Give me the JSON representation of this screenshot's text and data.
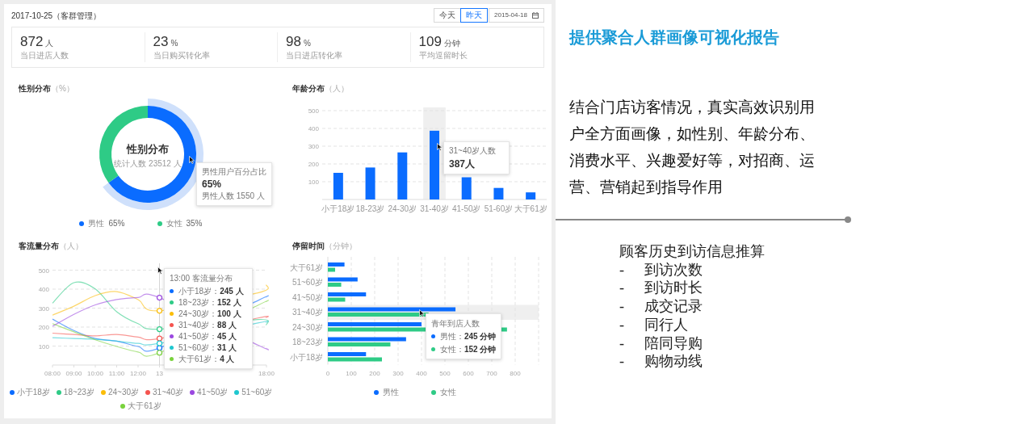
{
  "dashboard": {
    "header": {
      "title": "2017-10-25（客群管理）",
      "buttons": [
        {
          "label": "今天",
          "selected": false
        },
        {
          "label": "昨天",
          "selected": true
        }
      ],
      "date": "2015-04-18"
    },
    "stats": [
      {
        "value": "872",
        "unit": "人",
        "label": "当日进店人数"
      },
      {
        "value": "23",
        "unit": "%",
        "label": "当日购买转化率"
      },
      {
        "value": "98",
        "unit": "%",
        "label": "当日进店转化率"
      },
      {
        "value": "109",
        "unit": "分钟",
        "label": "平均逗留时长"
      }
    ],
    "gender": {
      "title": "性别分布",
      "unit": "（%）",
      "center_title": "性别分布",
      "center_subtitle": "统计人数 23512 人",
      "chart_data": {
        "type": "donut",
        "categories": [
          "男性",
          "女性"
        ],
        "values": [
          65,
          35
        ]
      },
      "legend": [
        {
          "value": "65%",
          "color": "#0a6cff",
          "highlighted": true
        },
        {
          "value": "35%",
          "color": "#2ecb86",
          "highlighted": false
        }
      ],
      "tooltip": {
        "title": "男性用户百分占比",
        "value": "65%",
        "detail": "男性人数 1550 人"
      }
    },
    "age": {
      "title": "年龄分布",
      "unit": "（人）",
      "chart_data": {
        "type": "bar",
        "categories": [
          "小于18岁",
          "18-23岁",
          "24-30岁",
          "31-40岁",
          "41-50岁",
          "51-60岁",
          "大于61岁"
        ],
        "values": [
          150,
          180,
          265,
          387,
          125,
          65,
          40
        ],
        "ylim": [
          0,
          500
        ],
        "yticks": [
          100,
          200,
          300,
          400,
          500
        ],
        "grid": true,
        "bands": [
          {
            "axis": "x",
            "from": "31-40岁",
            "to": "31-40岁"
          }
        ]
      },
      "tooltip": {
        "title": "31~40岁人数",
        "value": "387人"
      }
    },
    "traffic": {
      "title": "客流量分布",
      "unit": "（人）",
      "chart_data": {
        "type": "line",
        "x": [
          8,
          9,
          10,
          11,
          12,
          13,
          17.6,
          18
        ],
        "xlim": [
          8,
          18
        ],
        "xticks": [
          {
            "value": 8,
            "label": "08:00"
          },
          {
            "value": 9,
            "label": "09:00"
          },
          {
            "value": 10,
            "label": "10:00"
          },
          {
            "value": 11,
            "label": "11:00"
          },
          {
            "value": 12,
            "label": "12:00"
          },
          {
            "value": 13,
            "label": "13"
          },
          {
            "value": 18,
            "label": "18:00"
          }
        ],
        "ylim": [
          0,
          500
        ],
        "yticks": [
          100,
          200,
          300,
          400,
          500
        ],
        "grid": true,
        "ref_lines": [
          {
            "axis": "x",
            "value": 13
          }
        ],
        "series": [
          {
            "name": "小于18岁",
            "color": "#0a6cff",
            "values": [
              242,
              182,
              140,
              126,
              98,
              90,
              340,
              359
            ]
          },
          {
            "name": "18~23岁",
            "color": "#2ecb86",
            "values": [
              326,
              434,
              401,
              281,
              218,
              189,
              240,
              211
            ]
          },
          {
            "name": "24~30岁",
            "color": "#fbbd08",
            "values": [
              263,
              310,
              366,
              387,
              345,
              286,
              380,
              423
            ]
          },
          {
            "name": "31~40岁",
            "color": "#f5544f",
            "values": [
              168,
              161,
              154,
              161,
              147,
              140,
              248,
              250
            ]
          },
          {
            "name": "41~50岁",
            "color": "#9b48e0",
            "values": [
              204,
              267,
              317,
              345,
              356,
              355,
              105,
              88
            ]
          },
          {
            "name": "51~60岁",
            "color": "#1fc7cf",
            "values": [
              144,
              140,
              136,
              126,
              114,
              114,
              222,
              225
            ]
          },
          {
            "name": "大于61岁",
            "color": "#79d23c",
            "values": [
              218,
              175,
              133,
              98,
              69,
              65,
              315,
              335
            ]
          }
        ]
      },
      "tooltip": {
        "title": "13:00 客流量分布",
        "rows": [
          {
            "label": "小于18岁：",
            "value": "245 人"
          },
          {
            "label": "18~23岁：",
            "value": "152 人"
          },
          {
            "label": "24~30岁：",
            "value": "100 人"
          },
          {
            "label": "31~40岁：",
            "value": "88 人"
          },
          {
            "label": "41~50岁：",
            "value": "45 人"
          },
          {
            "label": "51~60岁：",
            "value": "31 人"
          },
          {
            "label": "大于61岁：",
            "value": "4 人"
          }
        ]
      }
    },
    "dwell": {
      "title": "停留时间",
      "unit": "（分钟）",
      "chart_data": {
        "type": "bar",
        "orientation": "horizontal",
        "categories": [
          "大于61岁",
          "51~60岁",
          "41~50岁",
          "31~40岁",
          "24~30岁",
          "18~23岁",
          "小于18岁"
        ],
        "xlim": [
          0,
          900
        ],
        "xticks": [
          0,
          100,
          200,
          300,
          400,
          500,
          600,
          700,
          800
        ],
        "grid": true,
        "bands": [
          {
            "axis": "y",
            "from": "31~40岁",
            "to": "31~40岁"
          }
        ],
        "series": [
          {
            "name": "男性",
            "color": "#0a6cff",
            "values": [
              71,
              127,
              163,
              545,
              400,
              334,
              163
            ]
          },
          {
            "name": "女性",
            "color": "#2ecb86",
            "values": [
              31,
              57,
              74,
              430,
              765,
              267,
              231
            ]
          }
        ]
      },
      "tooltip": {
        "title": "青年到店人数",
        "rows": [
          {
            "label": "男性：",
            "value": "245 分钟"
          },
          {
            "label": "女性：",
            "value": "152 分钟"
          }
        ]
      }
    }
  },
  "report": {
    "title": "提供聚合人群画像可视化报告",
    "description": "结合门店访客情况，真实高效识别用户全方面画像，如性别、年龄分布、消费水平、兴趣爱好等，对招商、运营、营销起到指导作用",
    "inference": {
      "heading": "顾客历史到访信息推算",
      "items": [
        {
          "bullet": "-",
          "text": "到访次数"
        },
        {
          "bullet": "-",
          "text": "到访时长"
        },
        {
          "bullet": "-",
          "text": "成交记录"
        },
        {
          "bullet": "-",
          "text": "同行人"
        },
        {
          "bullet": "-",
          "text": "陪同导购"
        },
        {
          "bullet": "-",
          "text": "购物动线"
        }
      ]
    }
  }
}
